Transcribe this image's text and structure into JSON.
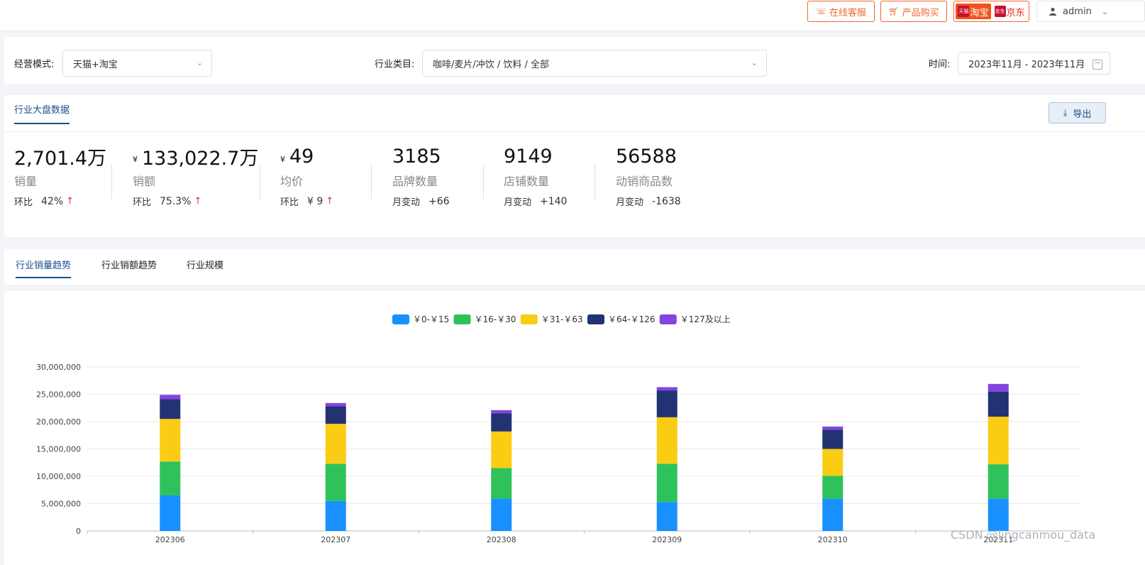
{
  "topbar": {
    "service_label": "在线客服",
    "buy_label": "产品购买",
    "platform_taobao_badge": "天猫",
    "platform_taobao": "淘宝",
    "platform_jd_badge": "京东",
    "platform_jd": "京东",
    "user": "admin",
    "colors": {
      "accent": "#f0662b"
    }
  },
  "filters": {
    "mode_label": "经营模式:",
    "mode_value": "天猫+淘宝",
    "industry_label": "行业类目:",
    "industry_value": "咖啡/麦片/冲饮 / 饮料 / 全部",
    "time_label": "时间:",
    "time_value": "2023年11月 - 2023年11月"
  },
  "overview": {
    "tab": "行业大盘数据",
    "export_label": "导出",
    "kpis": [
      {
        "value": "2,701.4万",
        "currency": "",
        "name": "销量",
        "change_label": "环比",
        "change_value": "42%",
        "trend": "up"
      },
      {
        "value": "133,022.7万",
        "currency": "¥",
        "name": "销额",
        "change_label": "环比",
        "change_value": "75.3%",
        "trend": "up"
      },
      {
        "value": "49",
        "currency": "¥",
        "name": "均价",
        "change_label": "环比",
        "change_value": "¥ 9",
        "trend": "up"
      },
      {
        "value": "3185",
        "currency": "",
        "name": "品牌数量",
        "change_label": "月变动",
        "change_value": "+66",
        "trend": ""
      },
      {
        "value": "9149",
        "currency": "",
        "name": "店铺数量",
        "change_label": "月变动",
        "change_value": "+140",
        "trend": ""
      },
      {
        "value": "56588",
        "currency": "",
        "name": "动销商品数",
        "change_label": "月变动",
        "change_value": "-1638",
        "trend": ""
      }
    ]
  },
  "chart_tabs": [
    "行业销量趋势",
    "行业销额趋势",
    "行业规模"
  ],
  "chart_data": {
    "type": "bar",
    "stacked": true,
    "categories": [
      "202306",
      "202307",
      "202308",
      "202309",
      "202310",
      "202311"
    ],
    "series": [
      {
        "name": "￥0-￥15",
        "color": "#1890ff",
        "values": [
          6500000,
          5500000,
          5900000,
          5300000,
          5900000,
          5900000
        ]
      },
      {
        "name": "￥16-￥30",
        "color": "#2fc25b",
        "values": [
          6200000,
          6800000,
          5600000,
          7000000,
          4200000,
          6300000
        ]
      },
      {
        "name": "￥31-￥63",
        "color": "#facc14",
        "values": [
          7800000,
          7300000,
          6700000,
          8500000,
          4900000,
          8700000
        ]
      },
      {
        "name": "￥64-￥126",
        "color": "#223273",
        "values": [
          3600000,
          3200000,
          3300000,
          4900000,
          3500000,
          4600000
        ]
      },
      {
        "name": "￥127及以上",
        "color": "#8543e0",
        "values": [
          800000,
          600000,
          600000,
          600000,
          600000,
          1400000
        ]
      }
    ],
    "yticks": [
      "0",
      "5,000,000",
      "10,000,000",
      "15,000,000",
      "20,000,000",
      "25,000,000",
      "30,000,000"
    ],
    "ylim": [
      0,
      30000000
    ],
    "legend_position": "top-center",
    "grid": true
  },
  "watermark": "CSDN @lingcanmou_data"
}
